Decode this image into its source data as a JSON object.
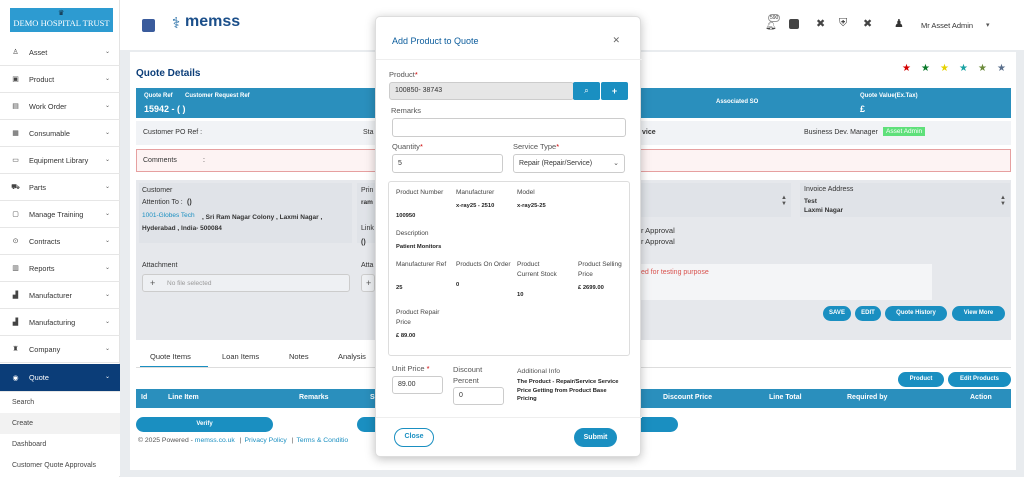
{
  "sidebar": {
    "logo_text": "DEMO HOSPITAL TRUST",
    "items": [
      {
        "label": "Asset",
        "icon": "asset-icon"
      },
      {
        "label": "Product",
        "icon": "product-icon"
      },
      {
        "label": "Work Order",
        "icon": "work-order-icon"
      },
      {
        "label": "Consumable",
        "icon": "grid-icon"
      },
      {
        "label": "Equipment Library",
        "icon": "equipment-icon"
      },
      {
        "label": "Parts",
        "icon": "parts-icon"
      },
      {
        "label": "Manage Training",
        "icon": "training-icon"
      },
      {
        "label": "Contracts",
        "icon": "contracts-icon"
      },
      {
        "label": "Reports",
        "icon": "reports-icon"
      },
      {
        "label": "Manufacturer",
        "icon": "manufacturer-icon"
      },
      {
        "label": "Manufacturing",
        "icon": "manufacturing-icon"
      },
      {
        "label": "Company",
        "icon": "company-icon"
      },
      {
        "label": "Quote",
        "icon": "quote-icon"
      }
    ],
    "sub_items": [
      "Search",
      "Create",
      "Dashboard",
      "Customer Quote Approvals"
    ]
  },
  "header": {
    "brand": "memss",
    "notification_count": "590",
    "user_name": "Mr Asset Admin"
  },
  "page": {
    "title": "Quote Details",
    "quote_ref_label": "Quote Ref",
    "customer_request_ref_label": "Customer Request Ref",
    "quote_ref_value": "15942 - ( )",
    "associated_so_label": "Associated SO",
    "quote_value_label": "Quote Value(Ex.Tax)",
    "quote_value": "£",
    "customer_po_ref_label": "Customer PO Ref :",
    "sta_label": "Sta",
    "vice_fragment": "vice",
    "business_dev_manager_label": "Business Dev. Manager",
    "business_dev_manager_value": "Asset Admin",
    "comments_label": "Comments",
    "comments_colon": ":",
    "customer_label": "Customer",
    "attention_to_label": "Attention To :",
    "attention_to_value": "()",
    "customer_link": "1001-Globes Tech",
    "customer_address": ", Sri Ram Nagar Colony , Laxmi Nagar , Hyderabad , India- 500084",
    "prin_label": "Prin",
    "prin_value": "ram",
    "link_label": "Link",
    "link_value": "()",
    "attachment_label": "Attachment",
    "no_file_selected": "No file selected",
    "atta_fragment": "Atta",
    "invoice_address_label": "Invoice Address",
    "invoice_name": "Test",
    "invoice_area": "Laxmi Nagar",
    "approval_1": "r Approval",
    "approval_2": "r Approval",
    "testing_note": "ed for testing purpose",
    "buttons": {
      "save": "SAVE",
      "edit": "EDIT",
      "quote_history": "Quote History",
      "view_more": "View More",
      "product": "Product",
      "edit_products": "Edit Products",
      "verify": "Verify"
    },
    "tabs": [
      "Quote Items",
      "Loan Items",
      "Notes",
      "Analysis"
    ],
    "table_headers": [
      "Id",
      "Line Item",
      "Remarks",
      "S",
      "Discount Price",
      "Line Total",
      "Required by",
      "Action"
    ],
    "footer": {
      "copyright": "© 2025 Powered - ",
      "site": "memss.co.uk",
      "privacy": "Privacy Policy",
      "terms": "Terms & Conditio",
      "sep": "|"
    }
  },
  "modal": {
    "title": "Add Product to Quote",
    "product_label": "Product",
    "product_value": "100850- 38743",
    "remarks_label": "Remarks",
    "remarks_value": "",
    "quantity_label": "Quantity",
    "quantity_value": "5",
    "service_type_label": "Service Type",
    "service_type_value": "Repair (Repair/Service)",
    "info": {
      "product_number_label": "Product Number",
      "product_number_value": "100950",
      "manufacturer_label": "Manufacturer",
      "manufacturer_value": "x-ray25 - 2510",
      "model_label": "Model",
      "model_value": "x-ray25-25",
      "description_label": "Description",
      "description_value": "Patient Monitors",
      "manufacturer_ref_label": "Manufacturer Ref",
      "manufacturer_ref_value": "25",
      "products_on_order_label": "Products On Order",
      "products_on_order_value": "0",
      "current_stock_label": "Product Current Stock",
      "current_stock_value": "10",
      "selling_price_label": "Product Selling Price",
      "selling_price_value": "£ 2699.00",
      "repair_price_label": "Product Repair Price",
      "repair_price_value": "£ 89.00"
    },
    "unit_price_label": "Unit Price",
    "unit_price_value": "89.00",
    "discount_percent_label": "Discount Percent",
    "discount_percent_value": "0",
    "additional_info_label": "Additional Info",
    "additional_info_value": "The Product - Repair/Service Service Price Getting from Product Base Pricing",
    "close_label": "Close",
    "submit_label": "Submit"
  },
  "colors": {
    "primary": "#2a8fbd",
    "nav_active": "#0b3d78",
    "button": "#1a8fc1"
  }
}
